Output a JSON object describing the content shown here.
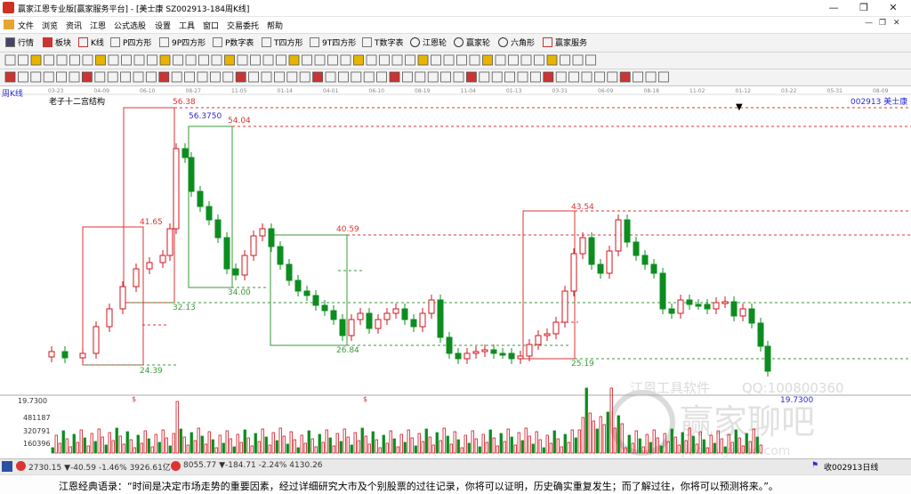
{
  "window": {
    "title": "赢家江恩专业版[赢家服务平台] - [美士康  SZ002913-184周K线]",
    "controls": [
      "—",
      "❐",
      "✕"
    ]
  },
  "menu": {
    "items": [
      "文件",
      "浏览",
      "资讯",
      "江恩",
      "公式选股",
      "设置",
      "工具",
      "窗口",
      "交易委托",
      "帮助"
    ],
    "right_controls": [
      "—",
      "❐",
      "✕"
    ]
  },
  "toolbar": {
    "items": [
      "行情",
      "板块",
      "K线",
      "P四方形",
      "9P四方形",
      "P数字表",
      "T四方形",
      "9T四方形",
      "T数字表",
      "江恩轮",
      "赢家轮",
      "六角形",
      "赢家服务"
    ]
  },
  "chart": {
    "period_label": "周K线",
    "indicator_title": "老子十二宫结构",
    "stock_label": "002913  美士康",
    "date_ticks": [
      "03-23",
      "04-09",
      "06-10",
      "08-27",
      "11-05",
      "01-14",
      "04-01",
      "06-10",
      "08-19",
      "11-04",
      "01-13",
      "03-31",
      "06-09",
      "08-18",
      "11-02",
      "01-12",
      "03-22",
      "05-31",
      "08-09"
    ],
    "price_labels": {
      "p1": "56.38",
      "p2": "56.3750",
      "p3": "54.04",
      "p4": "41.65",
      "p5": "40.59",
      "p6": "43.54",
      "p7": "34.00",
      "p8": "32.13",
      "p9": "26.84",
      "p10": "25.19",
      "p11": "24.39",
      "p12": "19.7300"
    },
    "volume_axis": [
      "19.7300",
      "481187",
      "320791",
      "160396"
    ],
    "volume_marks": [
      "$",
      "$"
    ],
    "watermark": {
      "text1": "江恩工具软件",
      "text2": "QQ:100800360",
      "brand": "赢家聊吧",
      "site": "jiaoba.yixiao.com"
    },
    "colors": {
      "up": "#d0161f",
      "down": "#0d8d1f",
      "box_red": "#d33",
      "box_green": "#3a9a3a"
    }
  },
  "status": {
    "sh_index": "2730.15 ▼-40.59 -1.46% 3926.61亿",
    "sz_index": "8055.77 ▼-184.71 -2.24% 4130.26",
    "right_text": "收002913日线"
  },
  "quote": "江恩经典语录：“时间是决定市场走势的重要因素，经过详细研究大市及个别股票的过往记录，你将可以证明，历史确实重复发生；而了解过往，你将可以预测将来。”。"
}
